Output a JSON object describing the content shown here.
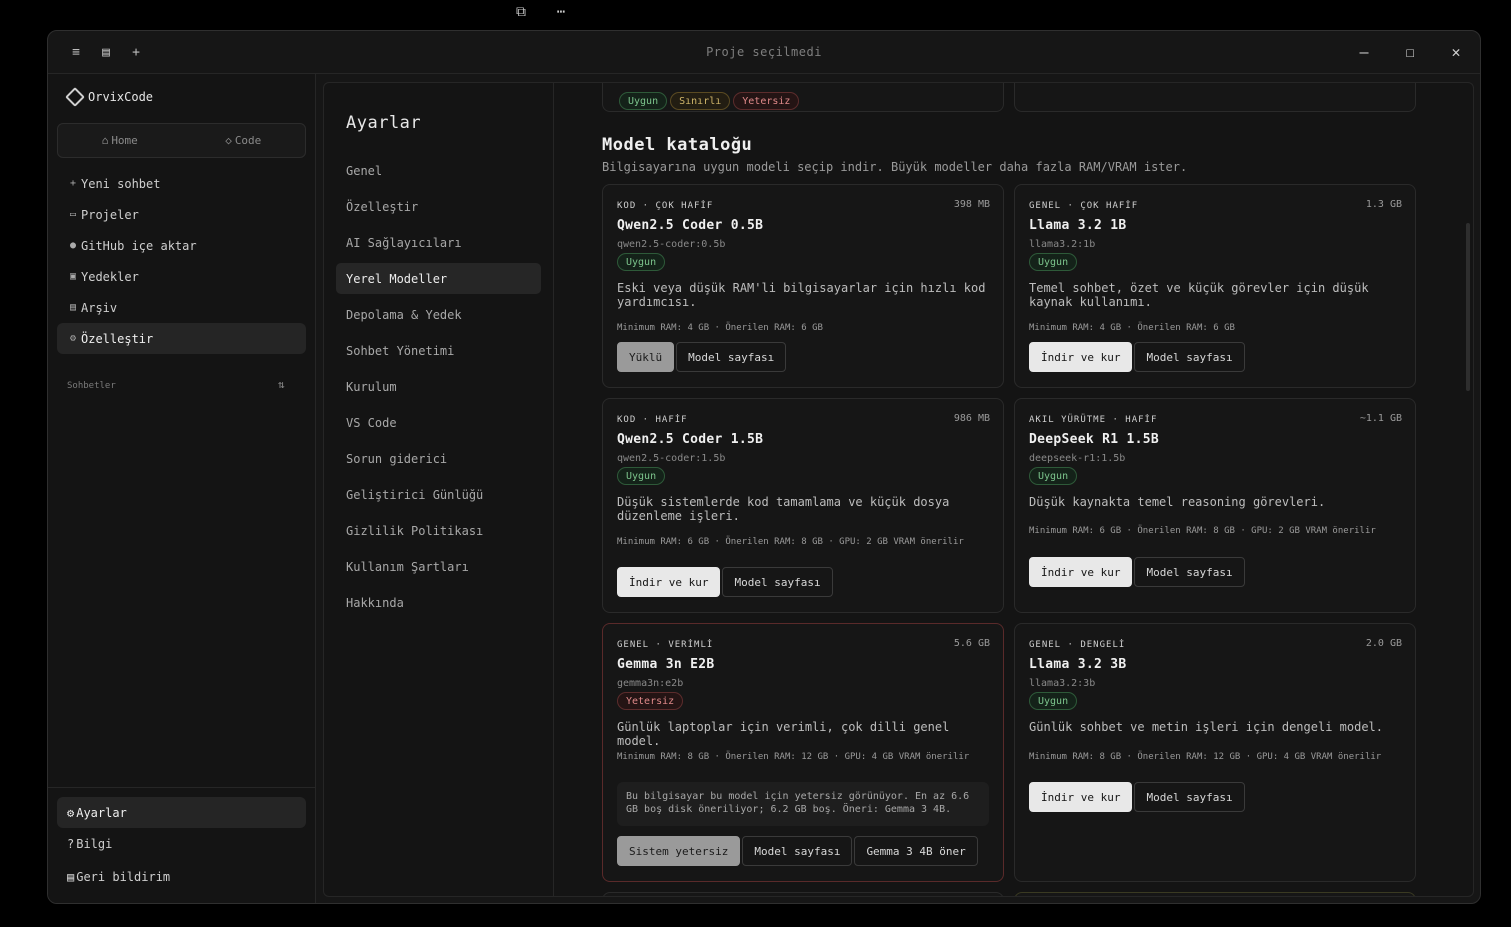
{
  "window": {
    "title": "Proje seçilmedi"
  },
  "sidebar": {
    "brand": "OrvixCode",
    "modes": [
      "Home",
      "Code"
    ],
    "items": [
      {
        "label": "Yeni sohbet",
        "icon": "plus-icon"
      },
      {
        "label": "Projeler",
        "icon": "folder-icon"
      },
      {
        "label": "GitHub içe aktar",
        "icon": "github-icon"
      },
      {
        "label": "Yedekler",
        "icon": "backup-icon"
      },
      {
        "label": "Arşiv",
        "icon": "archive-icon"
      },
      {
        "label": "Özelleştir",
        "icon": "customize-icon",
        "active": true
      }
    ],
    "chats_label": "Sohbetler",
    "bottom": [
      {
        "label": "Ayarlar",
        "icon": "gear-icon",
        "active": true
      },
      {
        "label": "Bilgi",
        "icon": "help-icon"
      },
      {
        "label": "Geri bildirim",
        "icon": "feedback-icon"
      }
    ]
  },
  "settings": {
    "title": "Ayarlar",
    "nav": [
      "Genel",
      "Özelleştir",
      "AI Sağlayıcıları",
      "Yerel Modeller",
      "Depolama & Yedek",
      "Sohbet Yönetimi",
      "Kurulum",
      "VS Code",
      "Sorun giderici",
      "Geliştirici Günlüğü",
      "Gizlilik Politikası",
      "Kullanım Şartları",
      "Hakkında"
    ],
    "active_nav": "Yerel Modeller"
  },
  "legend_chips": [
    "Uygun",
    "Sınırlı",
    "Yetersiz"
  ],
  "catalog": {
    "title": "Model kataloğu",
    "description": "Bilgisayarına uygun modeli seçip indir. Büyük modeller daha fazla RAM/VRAM ister.",
    "models": [
      {
        "category": "KOD · ÇOK HAFİF",
        "size": "398 MB",
        "name": "Qwen2.5 Coder 0.5B",
        "tag": "qwen2.5-coder:0.5b",
        "status": "Uygun",
        "status_kind": "ok",
        "desc": "Eski veya düşük RAM'li bilgisayarlar için hızlı kod yardımcısı.",
        "req": "Minimum RAM: 4 GB · Önerilen RAM: 6 GB",
        "actions": [
          {
            "label": "Yüklü",
            "kind": "disabled"
          },
          {
            "label": "Model sayfası",
            "kind": "secondary"
          }
        ]
      },
      {
        "category": "GENEL · ÇOK HAFİF",
        "size": "1.3 GB",
        "name": "Llama 3.2 1B",
        "tag": "llama3.2:1b",
        "status": "Uygun",
        "status_kind": "ok",
        "desc": "Temel sohbet, özet ve küçük görevler için düşük kaynak kullanımı.",
        "req": "Minimum RAM: 4 GB · Önerilen RAM: 6 GB",
        "actions": [
          {
            "label": "İndir ve kur",
            "kind": "primary"
          },
          {
            "label": "Model sayfası",
            "kind": "secondary"
          }
        ]
      },
      {
        "category": "KOD · HAFİF",
        "size": "986 MB",
        "name": "Qwen2.5 Coder 1.5B",
        "tag": "qwen2.5-coder:1.5b",
        "status": "Uygun",
        "status_kind": "ok",
        "desc": "Düşük sistemlerde kod tamamlama ve küçük dosya düzenleme işleri.",
        "req": "Minimum RAM: 6 GB · Önerilen RAM: 8 GB · GPU: 2 GB VRAM önerilir",
        "actions": [
          {
            "label": "İndir ve kur",
            "kind": "primary"
          },
          {
            "label": "Model sayfası",
            "kind": "secondary"
          }
        ]
      },
      {
        "category": "AKIL YÜRÜTME · HAFİF",
        "size": "~1.1 GB",
        "name": "DeepSeek R1 1.5B",
        "tag": "deepseek-r1:1.5b",
        "status": "Uygun",
        "status_kind": "ok",
        "desc": "Düşük kaynakta temel reasoning görevleri.",
        "req": "Minimum RAM: 6 GB · Önerilen RAM: 8 GB · GPU: 2 GB VRAM önerilir",
        "actions": [
          {
            "label": "İndir ve kur",
            "kind": "primary"
          },
          {
            "label": "Model sayfası",
            "kind": "secondary"
          }
        ]
      },
      {
        "category": "GENEL · VERİMLİ",
        "size": "5.6 GB",
        "name": "Gemma 3n E2B",
        "tag": "gemma3n:e2b",
        "status": "Yetersiz",
        "status_kind": "bad",
        "desc": "Günlük laptoplar için verimli, çok dilli genel model.",
        "req": "Minimum RAM: 8 GB · Önerilen RAM: 12 GB · GPU: 4 GB VRAM önerilir",
        "note": "Bu bilgisayar bu model için yetersiz görünüyor. En az 6.6 GB boş disk öneriliyor; 6.2 GB boş. Öneri: Gemma 3 4B.",
        "actions": [
          {
            "label": "Sistem yetersiz",
            "kind": "disabled"
          },
          {
            "label": "Model sayfası",
            "kind": "secondary"
          },
          {
            "label": "Gemma 3 4B öner",
            "kind": "secondary"
          }
        ]
      },
      {
        "category": "GENEL · DENGELİ",
        "size": "2.0 GB",
        "name": "Llama 3.2 3B",
        "tag": "llama3.2:3b",
        "status": "Uygun",
        "status_kind": "ok",
        "desc": "Günlük sohbet ve metin işleri için dengeli model.",
        "req": "Minimum RAM: 8 GB · Önerilen RAM: 12 GB · GPU: 4 GB VRAM önerilir",
        "actions": [
          {
            "label": "İndir ve kur",
            "kind": "primary"
          },
          {
            "label": "Model sayfası",
            "kind": "secondary"
          }
        ]
      }
    ]
  }
}
